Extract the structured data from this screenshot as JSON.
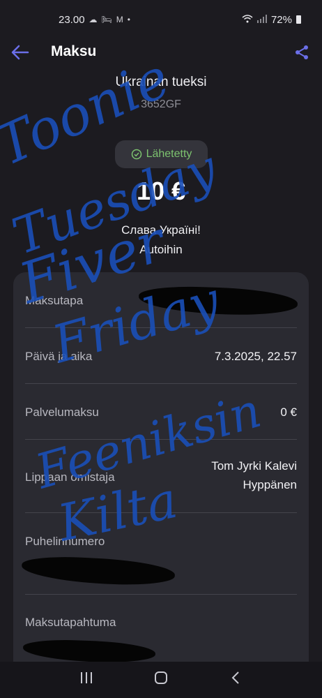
{
  "status_bar": {
    "time": "23.00",
    "notif_icons": [
      "cloud-icon",
      "bed-icon",
      "mail-icon",
      "dot-icon"
    ],
    "battery": "72%"
  },
  "app_bar": {
    "title": "Maksu"
  },
  "ticket": {
    "product_name": "Ukrainan tueksi",
    "product_code": "3652GF",
    "status": "Lähetetty",
    "amount": "10 €",
    "message_line1": "Слава Україні!",
    "message_line2": "Autoihin"
  },
  "details": {
    "payment_method_label": "Maksutapa",
    "datetime_label": "Päivä ja aika",
    "datetime_value": "7.3.2025, 22.57",
    "service_fee_label": "Palvelumaksu",
    "service_fee_value": "0 €",
    "owner_label": "Lippaan omistaja",
    "owner_value_line1": "Tom Jyrki Kalevi",
    "owner_value_line2": "Hyppänen",
    "phone_label": "Puhelinnumero",
    "transaction_label": "Maksutapahtuma"
  },
  "colors": {
    "accent": "#6b6fe8",
    "success": "#7dc36f",
    "background": "#1c1b20",
    "card": "#2a2a31",
    "handwriting": "#1a4fb8"
  },
  "handwriting_text": [
    "Toonie",
    "Tuesday",
    "Fiver",
    "Friday",
    "Feeniksin",
    "Kilta"
  ]
}
